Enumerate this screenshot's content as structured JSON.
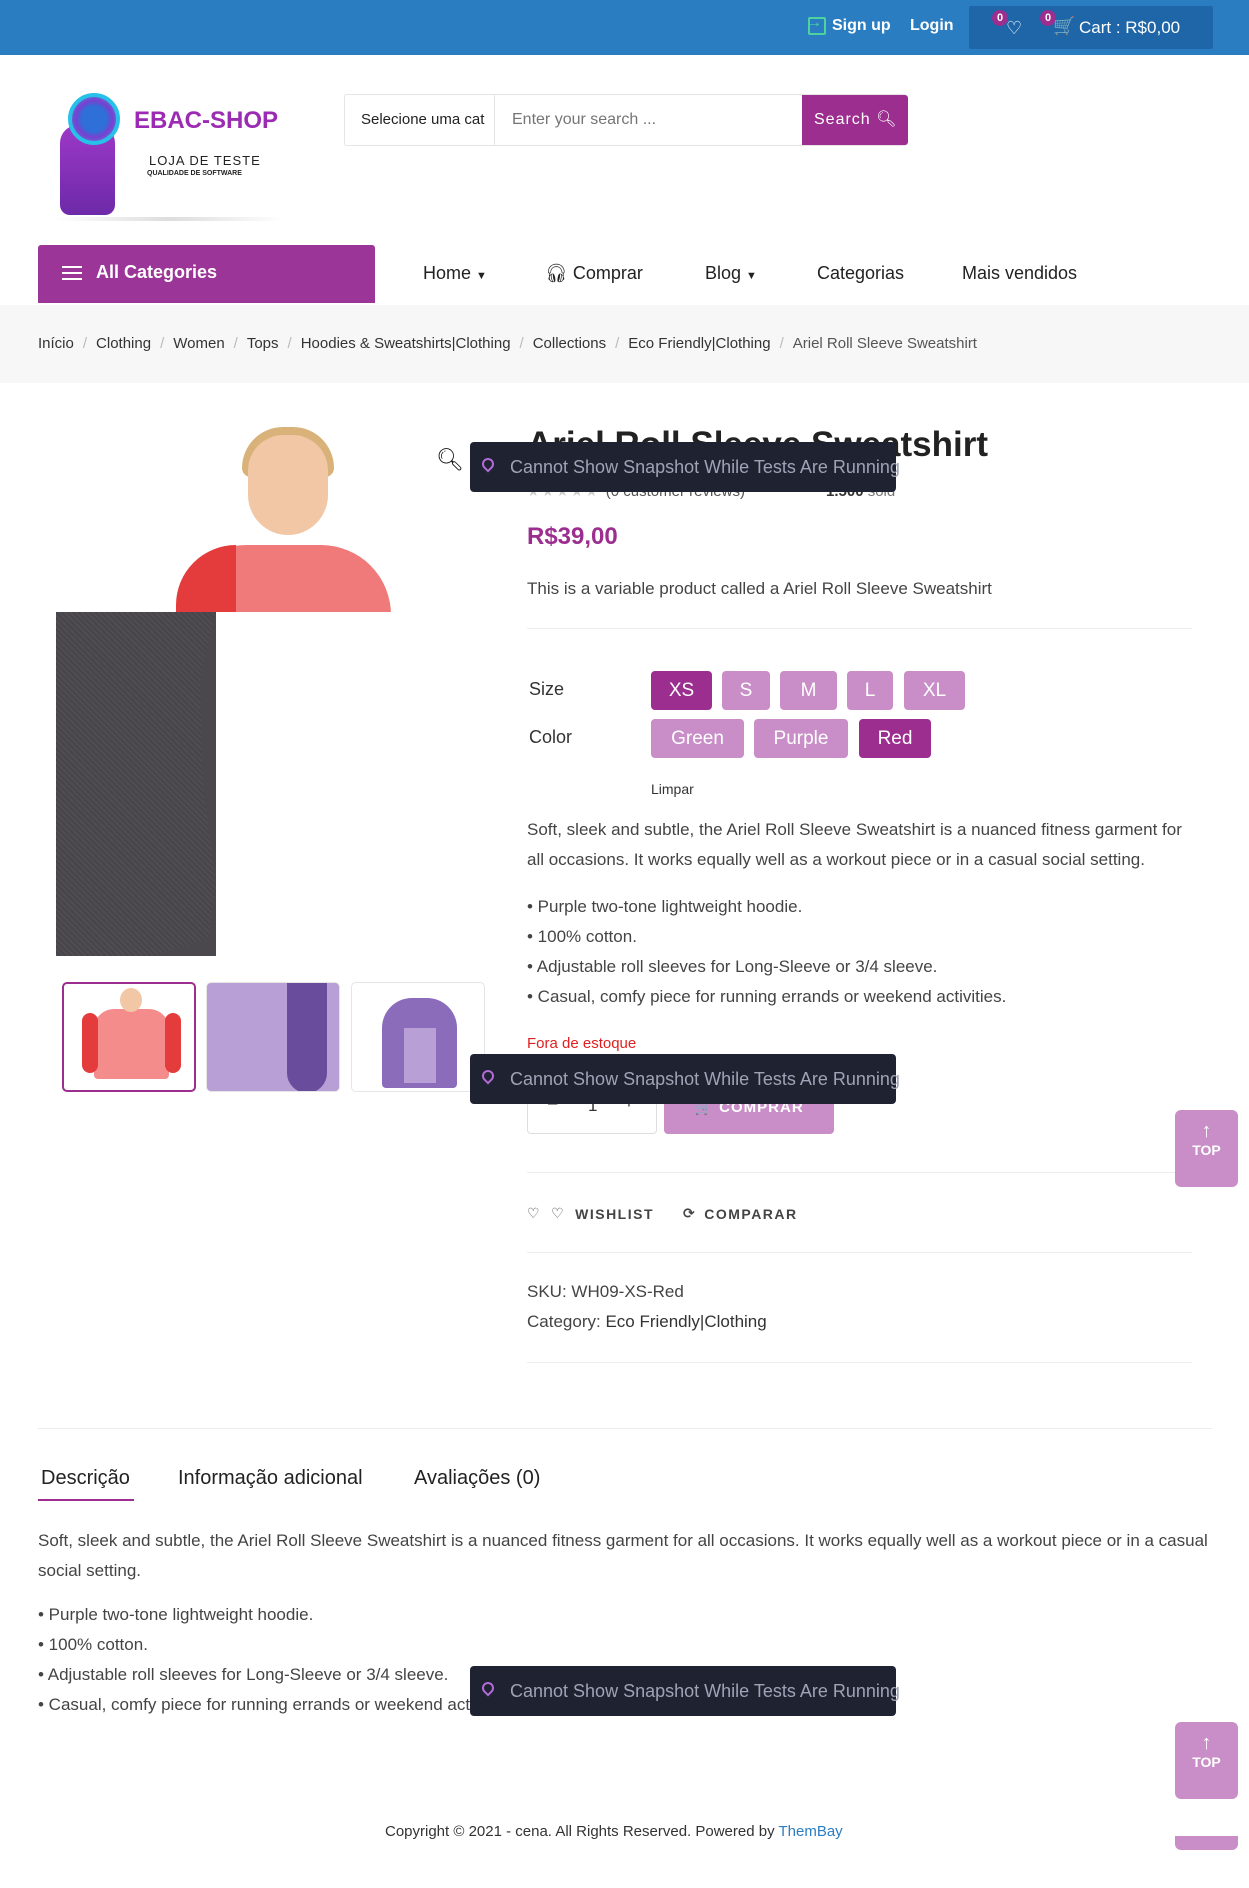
{
  "topbar": {
    "signup": "Sign up",
    "login": "Login",
    "wishlist_count": "0",
    "cart_count": "0",
    "cart_label": "Cart : R$0,00"
  },
  "logo": {
    "brand": "EBAC-SHOP",
    "line1": "LOJA DE TESTE",
    "line2": "QUALIDADE DE SOFTWARE"
  },
  "search": {
    "category": "Selecione uma cat",
    "placeholder": "Enter your search ...",
    "button": "Search"
  },
  "nav": {
    "all_categories": "All Categories",
    "items": [
      "Home",
      "Comprar",
      "Blog",
      "Categorias",
      "Mais vendidos"
    ]
  },
  "breadcrumb": [
    "Início",
    "Clothing",
    "Women",
    "Tops",
    "Hoodies & Sweatshirts|Clothing",
    "Collections",
    "Eco Friendly|Clothing",
    "Ariel Roll Sleeve Sweatshirt"
  ],
  "product": {
    "title": "Ariel Roll Sleeve Sweatshirt",
    "reviews": "(0 customer reviews)",
    "sold_count": "1.500",
    "sold_label": "sold",
    "price": "R$39,00",
    "short_description": "This is a variable product called a Ariel Roll Sleeve Sweatshirt",
    "size_label": "Size",
    "sizes": [
      "XS",
      "S",
      "M",
      "L",
      "XL"
    ],
    "size_selected": "XS",
    "color_label": "Color",
    "colors": [
      "Green",
      "Purple",
      "Red"
    ],
    "color_selected": "Red",
    "clear": "Limpar",
    "description": "Soft, sleek and subtle, the Ariel Roll Sleeve Sweatshirt is a nuanced fitness garment for all occasions. It works equally well as a workout piece or in a casual social setting.",
    "bullets": [
      "• Purple two-tone lightweight hoodie.",
      "• 100% cotton.",
      "• Adjustable roll sleeves for Long-Sleeve or 3/4 sleeve.",
      "• Casual, comfy piece for running errands or weekend activities."
    ],
    "stock": "Fora de estoque",
    "qty_minus": "–",
    "qty": "1",
    "qty_plus": "+",
    "buy_button": "COMPRAR",
    "wishlist": "WISHLIST",
    "compare": "COMPARAR",
    "sku_label": "SKU:",
    "sku": "WH09-XS-Red",
    "category_label": "Category:",
    "category": "Eco Friendly|Clothing"
  },
  "overlay": {
    "message": "Cannot Show Snapshot While Tests Are Running"
  },
  "top_button": "TOP",
  "tabs": {
    "items": [
      "Descrição",
      "Informação adicional",
      "Avaliações (0)"
    ],
    "active": "Descrição",
    "description": "Soft, sleek and subtle, the Ariel Roll Sleeve Sweatshirt is a nuanced fitness garment for all occasions. It works equally well as a workout piece or in a casual social setting.",
    "bullets": [
      "• Purple two-tone lightweight hoodie.",
      "• 100% cotton.",
      "• Adjustable roll sleeves for Long-Sleeve or 3/4 sleeve.",
      "• Casual, comfy piece for running errands or weekend activities."
    ]
  },
  "footer": {
    "text": "Copyright © 2021 - cena. All Rights Reserved. Powered by ",
    "link": "ThemBay"
  },
  "colors": {
    "topbar": "#2b7dc1",
    "accent": "#9b2e8f",
    "accent_light": "#c98ec7",
    "error": "#e02020"
  }
}
